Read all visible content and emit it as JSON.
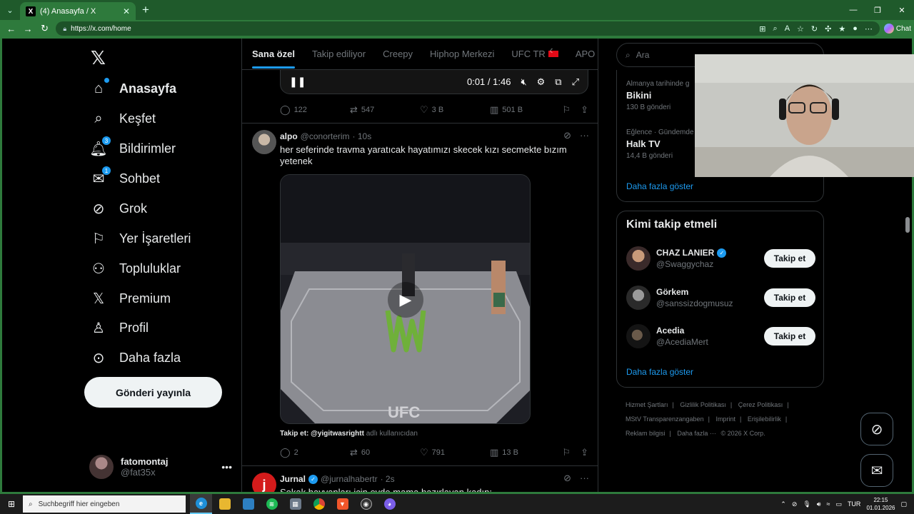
{
  "browser": {
    "tab_title": "(4) Anasayfa / X",
    "url": "https://x.com/home",
    "chat_label": "Chat"
  },
  "sidebar": {
    "logo": "𝕏",
    "items": [
      {
        "label": "Anasayfa",
        "icon": "home-icon",
        "glyph": "⌂"
      },
      {
        "label": "Keşfet",
        "icon": "search-icon",
        "glyph": "⌕"
      },
      {
        "label": "Bildirimler",
        "icon": "bell-icon",
        "glyph": "🔔︎",
        "badge": "3"
      },
      {
        "label": "Sohbet",
        "icon": "envelope-icon",
        "glyph": "✉",
        "badge": "1"
      },
      {
        "label": "Grok",
        "icon": "grok-icon",
        "glyph": "⊘"
      },
      {
        "label": "Yer İşaretleri",
        "icon": "bookmark-icon",
        "glyph": "⚐"
      },
      {
        "label": "Topluluklar",
        "icon": "communities-icon",
        "glyph": "⚇"
      },
      {
        "label": "Premium",
        "icon": "x-premium-icon",
        "glyph": "𝕏"
      },
      {
        "label": "Profil",
        "icon": "profile-icon",
        "glyph": "♙"
      },
      {
        "label": "Daha fazla",
        "icon": "more-circle-icon",
        "glyph": "⊙"
      }
    ],
    "post_button": "Gönderi yayınla",
    "account": {
      "name": "fatomontaj",
      "handle": "@fat35x"
    }
  },
  "main": {
    "tabs": [
      "Sana özel",
      "Takip ediliyor",
      "Creepy",
      "Hiphop Merkezi",
      "UFC TR",
      "APO"
    ],
    "video_time": "0:01 / 1:46",
    "post0_stats": {
      "replies": "122",
      "reposts": "547",
      "likes": "3 B",
      "views": "501 B"
    },
    "post1": {
      "name": "alpo",
      "handle": "@conorterim",
      "time": "· 10s",
      "text": "her seferinde travma yaratıcak hayatımızı skecek kızı secmekte bızım yetenek",
      "caption_prefix": "Takip et: @yigitwasrightt",
      "caption_suffix": "adlı kullanıcıdan",
      "stats": {
        "replies": "2",
        "reposts": "60",
        "likes": "791",
        "views": "13 B"
      }
    },
    "post2": {
      "name": "Jurnal",
      "handle": "@jurnalhabertr",
      "time": "· 2s",
      "text": "Sokak hayvanları için evde mama hazırlayan kadın:"
    }
  },
  "right": {
    "search_placeholder": "Ara",
    "trends": [
      {
        "category": "Almanya tarihinde g",
        "name": "Bikini",
        "count": "130 B gönderi"
      },
      {
        "category": "Eğlence · Gündemde",
        "name": "Halk TV",
        "count": "14,4 B gönderi"
      }
    ],
    "show_more": "Daha fazla göster",
    "who_title": "Kimi takip etmeli",
    "suggestions": [
      {
        "name": "CHAZ LANIER",
        "handle": "@Swaggychaz",
        "verified": true
      },
      {
        "name": "Görkem",
        "handle": "@sanssizdogmusuz",
        "verified": false
      },
      {
        "name": "Acedia",
        "handle": "@AcediaMert",
        "verified": false
      }
    ],
    "follow_label": "Takip et",
    "footer": [
      "Hizmet Şartları",
      "Gizlilik Politikası",
      "Çerez Politikası",
      "MStV Transparenzangaben",
      "Imprint",
      "Erişilebilirlik",
      "Reklam bilgisi",
      "Daha fazla ···",
      "© 2026 X Corp."
    ]
  },
  "taskbar": {
    "search_placeholder": "Suchbegriff hier eingeben",
    "lang": "TUR",
    "time": "22:15",
    "date": "01.01.2026"
  },
  "colors": {
    "accent": "#1d9bf0",
    "chrome": "#2e7a3c",
    "border": "#2f3336",
    "muted": "#71767b"
  }
}
